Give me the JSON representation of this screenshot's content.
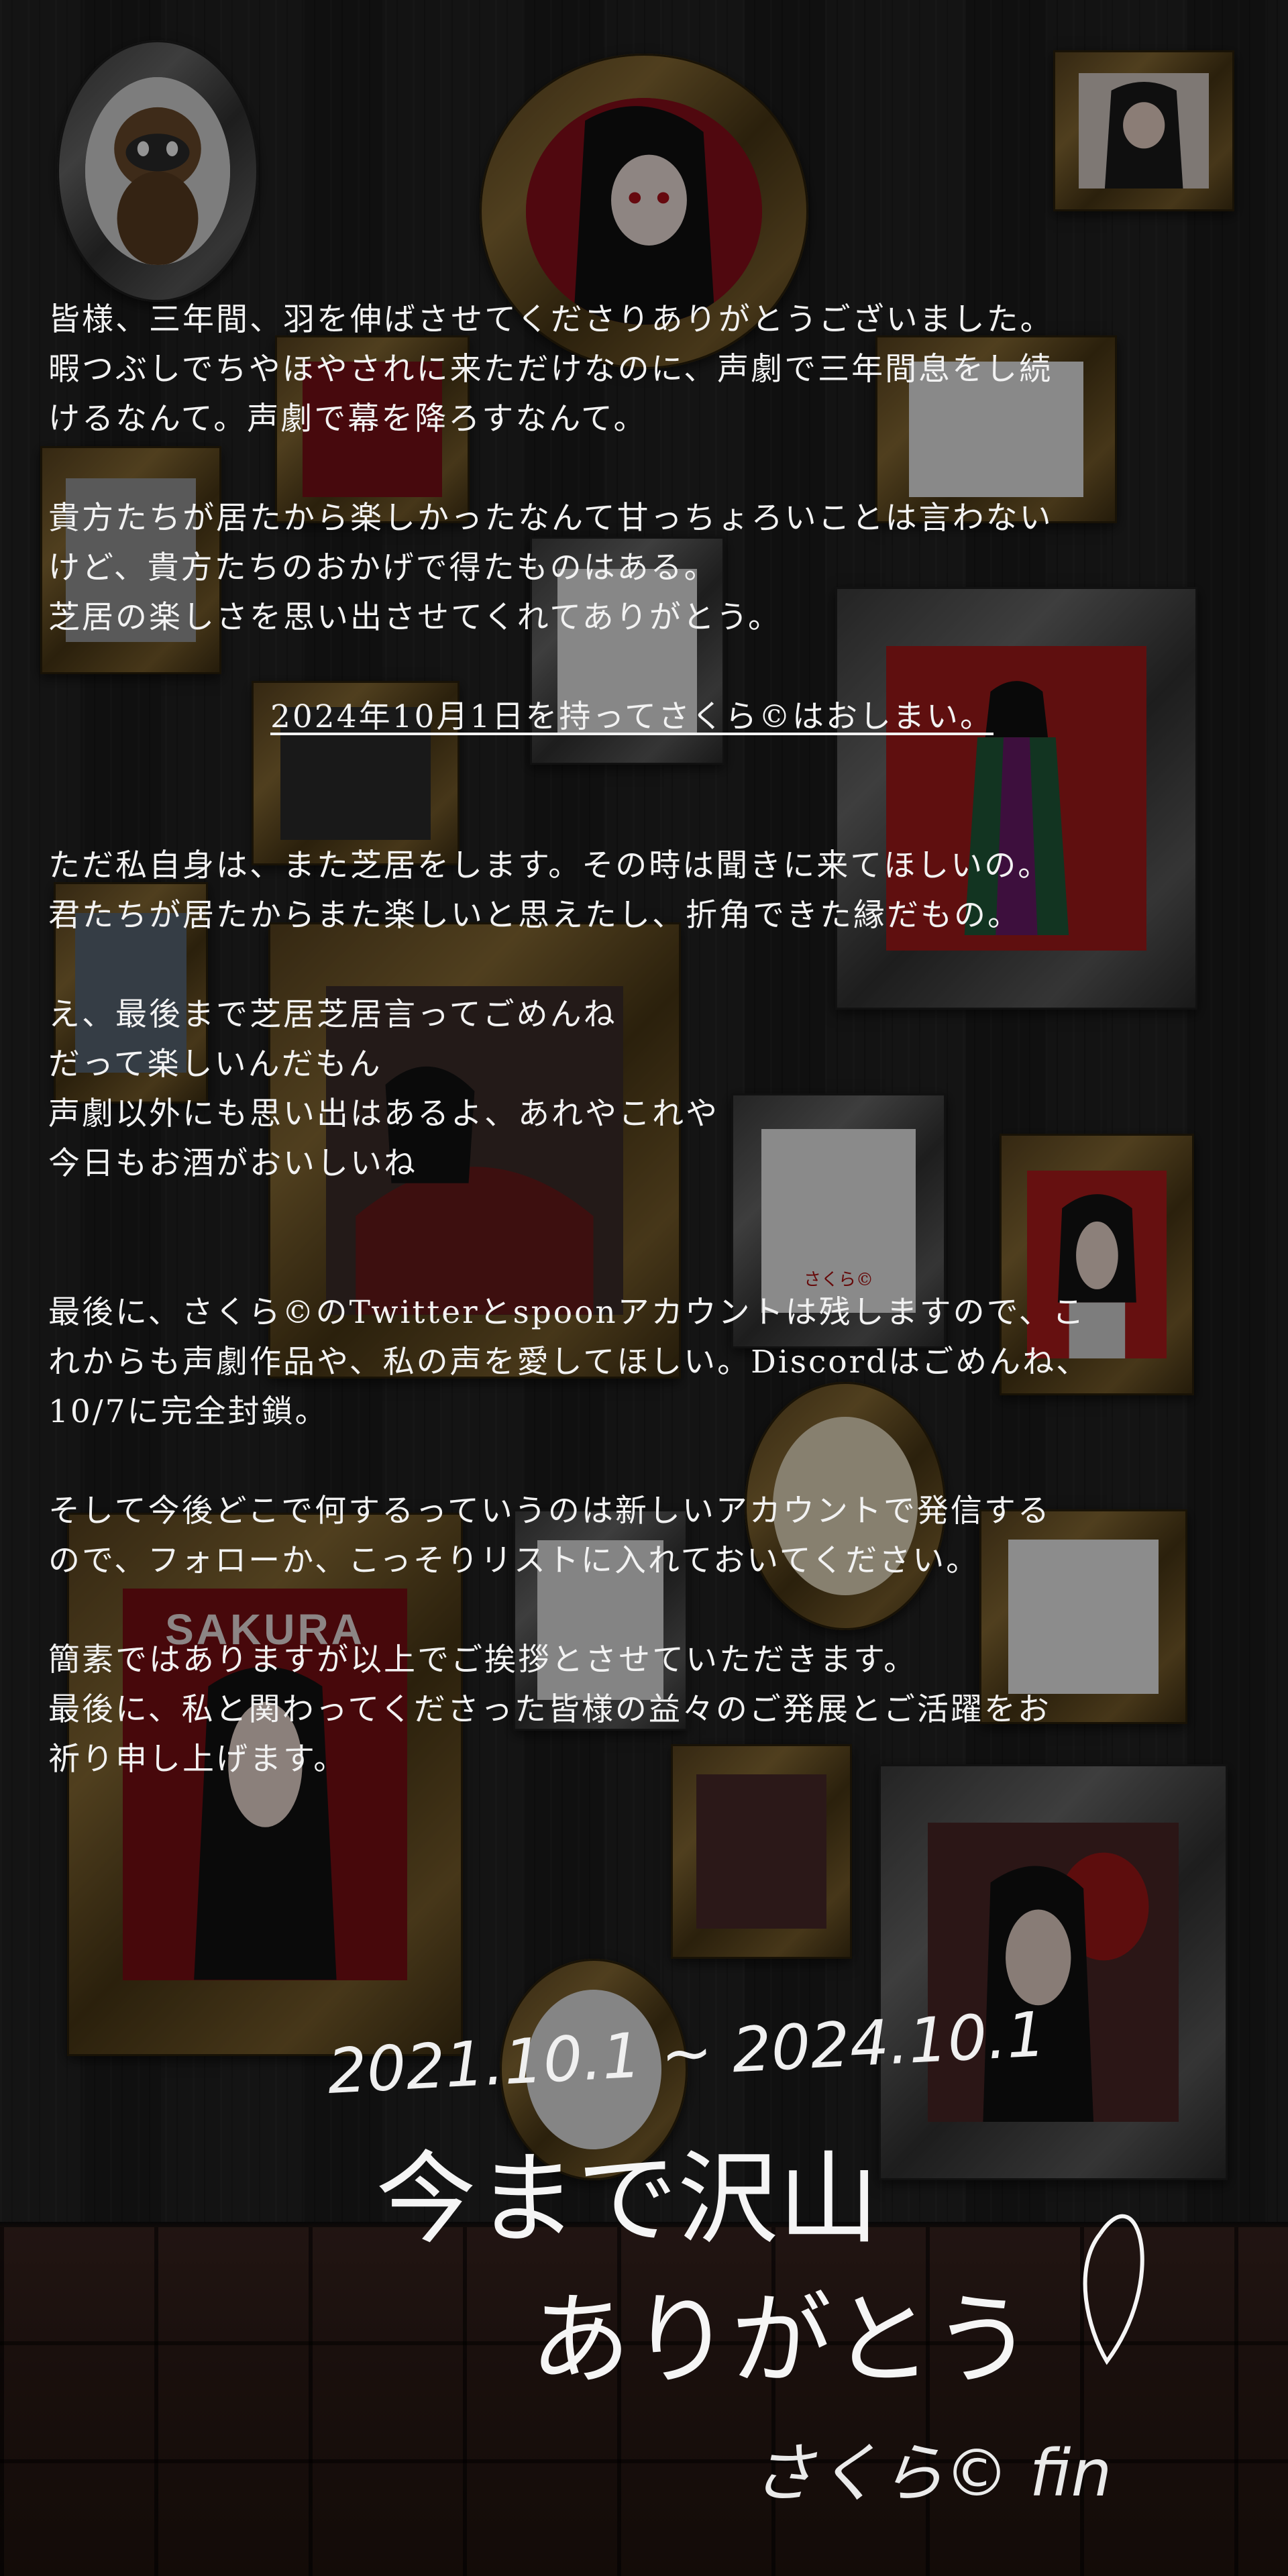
{
  "letter": {
    "p1_line1": "皆様、三年間、羽を伸ばさせてくださりありがとうございました。",
    "p1_line2": "暇つぶしでちやほやされに来ただけなのに、声劇で三年間息をし続",
    "p1_line3": "けるなんて。声劇で幕を降ろすなんて。",
    "p2_line1": "貴方たちが居たから楽しかったなんて甘っちょろいことは言わない",
    "p2_line2": "けど、貴方たちのおかげで得たものはある。",
    "p2_line3": "芝居の楽しさを思い出させてくれてありがとう。",
    "end_notice": "2024年10月1日を持ってさくら©はおしまい。",
    "p3_line1": "ただ私自身は、また芝居をします。その時は聞きに来てほしいの。",
    "p3_line2": "君たちが居たからまた楽しいと思えたし、折角できた縁だもの。",
    "p4_line1": "え、最後まで芝居芝居言ってごめんね",
    "p4_line2": "だって楽しいんだもん",
    "p4_line3": "声劇以外にも思い出はあるよ、あれやこれや",
    "p4_line4": "今日もお酒がおいしいね",
    "p5_line1": "最後に、さくら©のTwitterとspoonアカウントは残しますので、こ",
    "p5_line2": "れからも声劇作品や、私の声を愛してほしい。Discordはごめんね、",
    "p5_line3": "10/7に完全封鎖。",
    "p6_line1": "そして今後どこで何するっていうのは新しいアカウントで発信する",
    "p6_line2": "ので、フォローか、こっそりリストに入れておいてください。",
    "p7_line1": "簡素ではありますが以上でご挨拶とさせていただきます。",
    "p7_line2": "最後に、私と関わってくださった皆様の益々のご発展とご活躍をお",
    "p7_line3": "祈り申し上げます。"
  },
  "handwriting": {
    "dates": "2021.10.1 ~ 2024.10.1",
    "line1": "今まで沢山",
    "line2": "ありがとう",
    "signature": "さくら© fin"
  },
  "frame_art": {
    "poster_text": "SAKURA",
    "sticker_text": "さくら©"
  },
  "colors": {
    "text": "#f2f2f2",
    "wall": "#1f1f1f",
    "floor": "#2c1b17",
    "gold_frame": "#7a5f2c",
    "silver_frame": "#5c5c5c",
    "accent_red": "#8a0f1a"
  }
}
